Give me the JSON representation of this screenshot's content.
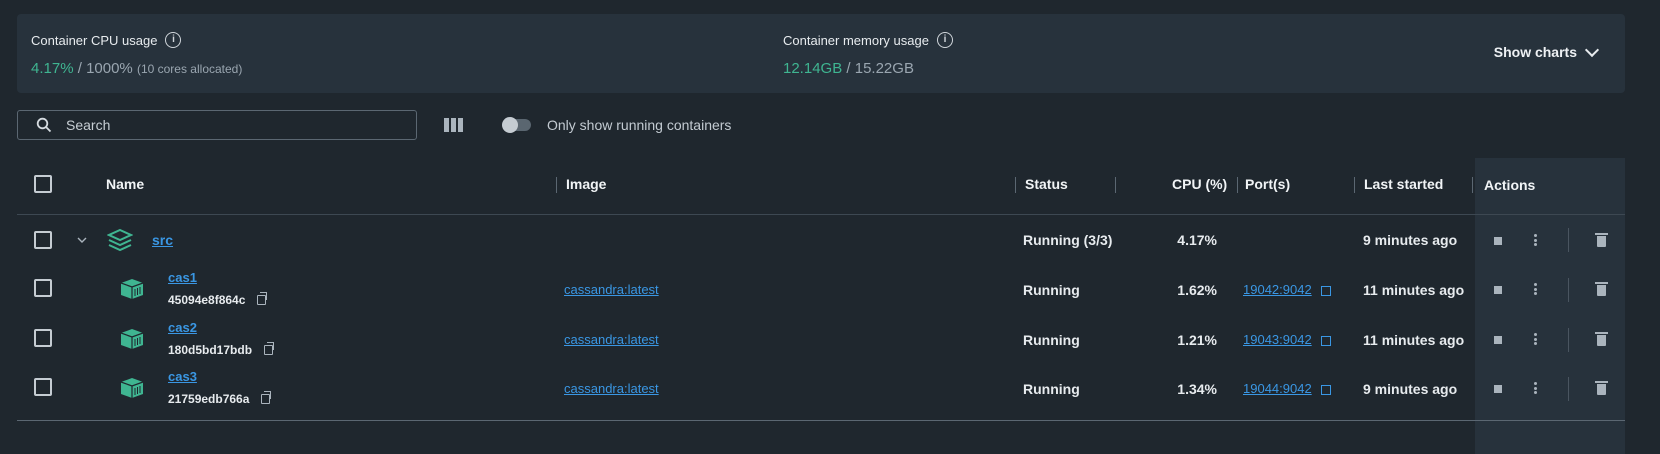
{
  "stats": {
    "cpu": {
      "label": "Container CPU usage",
      "used": "4.17%",
      "sep": "/",
      "total": "1000%",
      "note": "(10 cores allocated)"
    },
    "memory": {
      "label": "Container memory usage",
      "used": "12.14GB",
      "sep": "/",
      "total": "15.22GB"
    },
    "show_charts": "Show charts"
  },
  "toolbar": {
    "search_placeholder": "Search",
    "toggle_label": "Only show running containers",
    "toggle_on": false
  },
  "table": {
    "headers": {
      "name": "Name",
      "image": "Image",
      "status": "Status",
      "cpu": "CPU (%)",
      "ports": "Port(s)",
      "last_started": "Last started",
      "actions": "Actions"
    },
    "group": {
      "name": "src",
      "status": "Running (3/3)",
      "cpu": "4.17%",
      "last_started": "9 minutes ago"
    },
    "containers": [
      {
        "name": "cas1",
        "id": "45094e8f864c",
        "image": "cassandra:latest",
        "status": "Running",
        "cpu": "1.62%",
        "ports": "19042:9042",
        "last_started": "11 minutes ago"
      },
      {
        "name": "cas2",
        "id": "180d5bd17bdb",
        "image": "cassandra:latest",
        "status": "Running",
        "cpu": "1.21%",
        "ports": "19043:9042",
        "last_started": "11 minutes ago"
      },
      {
        "name": "cas3",
        "id": "21759edb766a",
        "image": "cassandra:latest",
        "status": "Running",
        "cpu": "1.34%",
        "ports": "19044:9042",
        "last_started": "9 minutes ago"
      }
    ]
  },
  "colors": {
    "accent_green": "#3fb591",
    "link_blue": "#3a97e4",
    "background": "#1f272e",
    "panel": "#27323c"
  }
}
